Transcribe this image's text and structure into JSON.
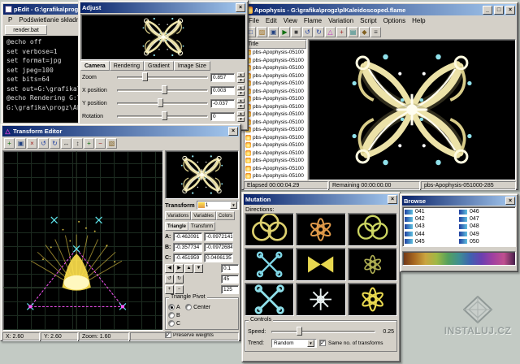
{
  "icons": {
    "close": "×",
    "minimize": "_",
    "maximize": "□",
    "dropdown": "▼",
    "spin_up": "▲",
    "spin_down": "▼",
    "check": "✓"
  },
  "pedit": {
    "title": "pEdit - G:\\grafika\\progz\\Apophysis",
    "menu": [
      "P",
      "Podświetlanie składni"
    ],
    "file_tab": "render.bat",
    "console": [
      "@echo off",
      "set verbose=1",
      "set format=jpg",
      "set jpeg=100",
      "set bits=64",
      "set out=G:\\grafika\\progz\\",
      "@echo Rendering G:\\grafika\\progz\\APOPHYSIS",
      "G:\\grafika\\progz\\APOPHYSIS\\render"
    ]
  },
  "adjust": {
    "title": "Adjust",
    "tabs": [
      "Camera",
      "Rendering",
      "Gradient",
      "Image Size"
    ],
    "fields": [
      {
        "label": "Zoom",
        "value": "0.857"
      },
      {
        "label": "X position",
        "value": "0.003"
      },
      {
        "label": "Y position",
        "value": "-0.037"
      },
      {
        "label": "Rotation",
        "value": "0"
      }
    ]
  },
  "main": {
    "title": "Apophysis - G:\\grafika\\progz\\plKaleidoscoped.flame",
    "menu": [
      "File",
      "Edit",
      "View",
      "Flame",
      "Variation",
      "Script",
      "Options",
      "Help"
    ],
    "toolbar": [
      "□",
      "▨",
      "▣",
      "▶",
      "■",
      "↺",
      "↻",
      "△",
      "+",
      "▤",
      "◆",
      "≡"
    ],
    "list_header": "Title",
    "flames": [
      "pbs-Apophysis-05100",
      "pbs-Apophysis-05100",
      "pbs-Apophysis-05100",
      "pbs-Apophysis-05100",
      "pbs-Apophysis-05100",
      "pbs-Apophysis-05100",
      "pbs-Apophysis-05100",
      "pbs-Apophysis-05100",
      "pbs-Apophysis-05100",
      "pbs-Apophysis-05100",
      "pbs-Apophysis-05100",
      "pbs-Apophysis-05100",
      "pbs-Apophysis-05100",
      "pbs-Apophysis-05100",
      "pbs-Apophysis-05100",
      "pbs-Apophysis-05100",
      "pbs-Apophysis-05100"
    ],
    "status": {
      "elapsed": "Elapsed 00:00:04.29",
      "remaining": "Remaining 00:00:00.00",
      "current": "pbs-Apophysis-051000-285"
    }
  },
  "transform_editor": {
    "title": "Transform Editor",
    "toolbar": [
      "+",
      "▣",
      "×",
      "↺",
      "↻",
      "↔",
      "↕",
      "+",
      "−",
      "▧"
    ],
    "panel_title": "Transform",
    "transform_selector": "1",
    "tabs_row1": [
      "Variations",
      "Variables",
      "Colors"
    ],
    "tabs_row2": [
      "Triangle",
      "Transform"
    ],
    "coords": [
      {
        "label": "A:",
        "x": "-0.462091",
        "y": "-0.0972141"
      },
      {
        "label": "B:",
        "x": "-0.357734",
        "y": "-0.0972684"
      },
      {
        "label": "C:",
        "x": "-0.451959",
        "y": "0.0406135"
      }
    ],
    "pad": [
      "◀",
      "▶",
      "▲",
      "▼",
      "↺",
      "↻",
      "+",
      "−"
    ],
    "move_step": "0.1",
    "rotate_step": "45",
    "scale_step": "125",
    "pivot_title": "Triangle Pivot",
    "pivot_options": [
      "A",
      "B",
      "C",
      "Center"
    ],
    "preserve_weights": "Preserve weights",
    "status": {
      "x": "X: 2.60",
      "y": "Y: 2.60",
      "zoom": "Zoom: 1.60"
    }
  },
  "mutation": {
    "title": "Mutation",
    "directions_label": "Directions:",
    "controls_label": "Controls",
    "speed_label": "Speed:",
    "speed_value": "0.25",
    "trend_label": "Trend:",
    "trend_value": "Random",
    "same_transforms_label": "Same no. of transforms"
  },
  "browser": {
    "title": "Browse",
    "items_col1": [
      "041",
      "042",
      "043",
      "044",
      "045"
    ],
    "items_col2": [
      "046",
      "047",
      "048",
      "049",
      "050"
    ],
    "gradient_colors": [
      "#6f3617",
      "#a8681f",
      "#caa43f",
      "#9fb844",
      "#55a05c",
      "#3f8f92",
      "#3f62b0",
      "#6a3fb0",
      "#a03fa0",
      "#c04f8f",
      "#46204a"
    ]
  },
  "watermark": {
    "text": "INSTALUJ.CZ"
  }
}
